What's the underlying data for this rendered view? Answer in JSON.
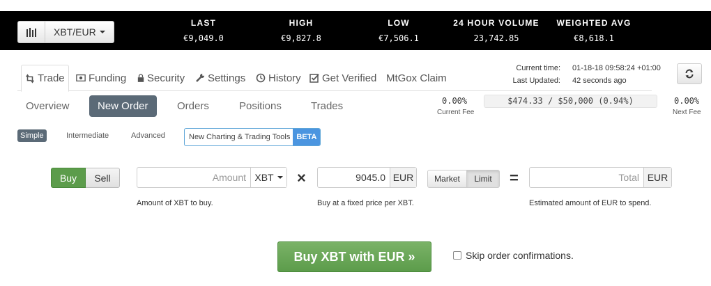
{
  "ticker": {
    "pair_label": "XBT/EUR",
    "stats": [
      {
        "label": "LAST",
        "value": "€9,049.0"
      },
      {
        "label": "HIGH",
        "value": "€9,827.8"
      },
      {
        "label": "LOW",
        "value": "€7,506.1"
      },
      {
        "label": "24 HOUR VOLUME",
        "value": "23,742.85"
      },
      {
        "label": "WEIGHTED AVG",
        "value": "€8,618.1"
      }
    ]
  },
  "tabs": [
    {
      "label": "Trade",
      "icon": "retweet-icon"
    },
    {
      "label": "Funding",
      "icon": "money-icon"
    },
    {
      "label": "Security",
      "icon": "lock-icon"
    },
    {
      "label": "Settings",
      "icon": "wrench-icon"
    },
    {
      "label": "History",
      "icon": "clock-icon"
    },
    {
      "label": "Get Verified",
      "icon": "check-square-icon"
    },
    {
      "label": "MtGox Claim"
    }
  ],
  "status": {
    "current_time_label": "Current time:",
    "current_time": "01-18-18 09:58:24 +01:00",
    "last_updated_label": "Last Updated:",
    "last_updated": "42 seconds ago"
  },
  "subnav": [
    "Overview",
    "New Order",
    "Orders",
    "Positions",
    "Trades"
  ],
  "fees": {
    "current_fee": "0.00%",
    "current_fee_label": "Current Fee",
    "volume_progress": "$474.33 / $50,000 (0.94%)",
    "next_fee": "0.00%",
    "next_fee_label": "Next Fee"
  },
  "modes": {
    "simple": "Simple",
    "intermediate": "Intermediate",
    "advanced": "Advanced",
    "tools": "New Charting & Trading Tools",
    "beta": "BETA"
  },
  "order": {
    "buy": "Buy",
    "sell": "Sell",
    "amount_placeholder": "Amount",
    "amount_currency": "XBT",
    "amount_help": "Amount of XBT to buy.",
    "times_symbol": "×",
    "price_value": "9045.0",
    "price_currency": "EUR",
    "price_help": "Buy at a fixed price per XBT.",
    "market": "Market",
    "limit": "Limit",
    "equals_symbol": "=",
    "total_placeholder": "Total",
    "total_currency": "EUR",
    "total_help": "Estimated amount of EUR to spend.",
    "submit": "Buy XBT with EUR »",
    "skip_label": "Skip order confirmations."
  }
}
